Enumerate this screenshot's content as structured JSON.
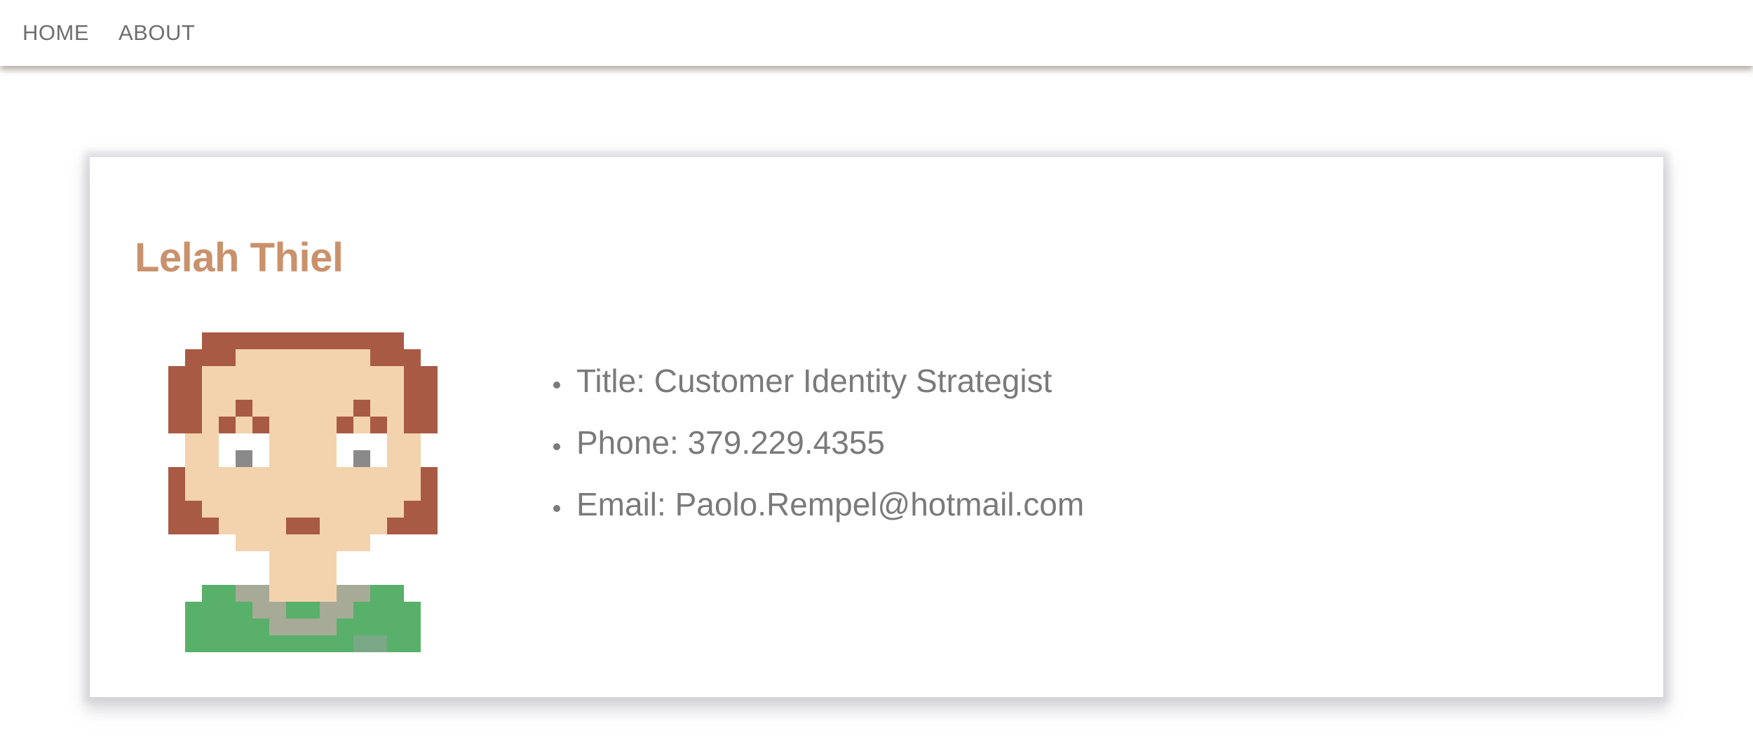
{
  "nav": {
    "home": "HOME",
    "about": "ABOUT"
  },
  "profile": {
    "name": "Lelah Thiel",
    "avatar_icon": "pixel-avatar-icon",
    "details": [
      "Title: Customer Identity Strategist",
      "Phone: 379.229.4355",
      "Email: Paolo.Rempel@hotmail.com"
    ]
  },
  "colors": {
    "name_accent": "#c9926c",
    "text": "#7a7a7a",
    "hair": "#a85a44",
    "skin": "#f2d3ae",
    "shirt": "#58b06a",
    "collar": "#a7aa96"
  }
}
